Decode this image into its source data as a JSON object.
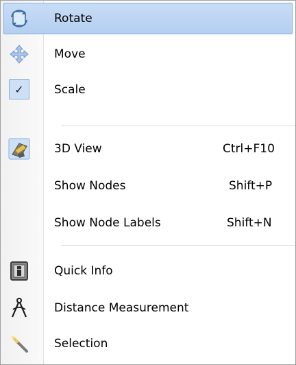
{
  "menu": {
    "items": [
      {
        "label": "Rotate",
        "icon": "rotate-icon",
        "state": "highlighted"
      },
      {
        "label": "Move",
        "icon": "move-icon"
      },
      {
        "label": "Scale",
        "icon": "check-icon",
        "checked": true
      },
      {
        "label": "3D View",
        "icon": "3d-view-icon",
        "shortcut": "Ctrl+F10"
      },
      {
        "label": "Show Nodes",
        "shortcut": "Shift+P"
      },
      {
        "label": "Show Node Labels",
        "shortcut": "Shift+N"
      },
      {
        "label": "Quick Info",
        "icon": "info-icon"
      },
      {
        "label": "Distance Measurement",
        "icon": "compass-icon"
      },
      {
        "label": "Selection",
        "icon": "wand-icon"
      }
    ],
    "check_glyph": "✓",
    "colors": {
      "highlight": "#b9d3f3",
      "highlight_border": "#84acdd",
      "gutter": "#f4f4f4",
      "separator": "#dcdcdc"
    }
  }
}
